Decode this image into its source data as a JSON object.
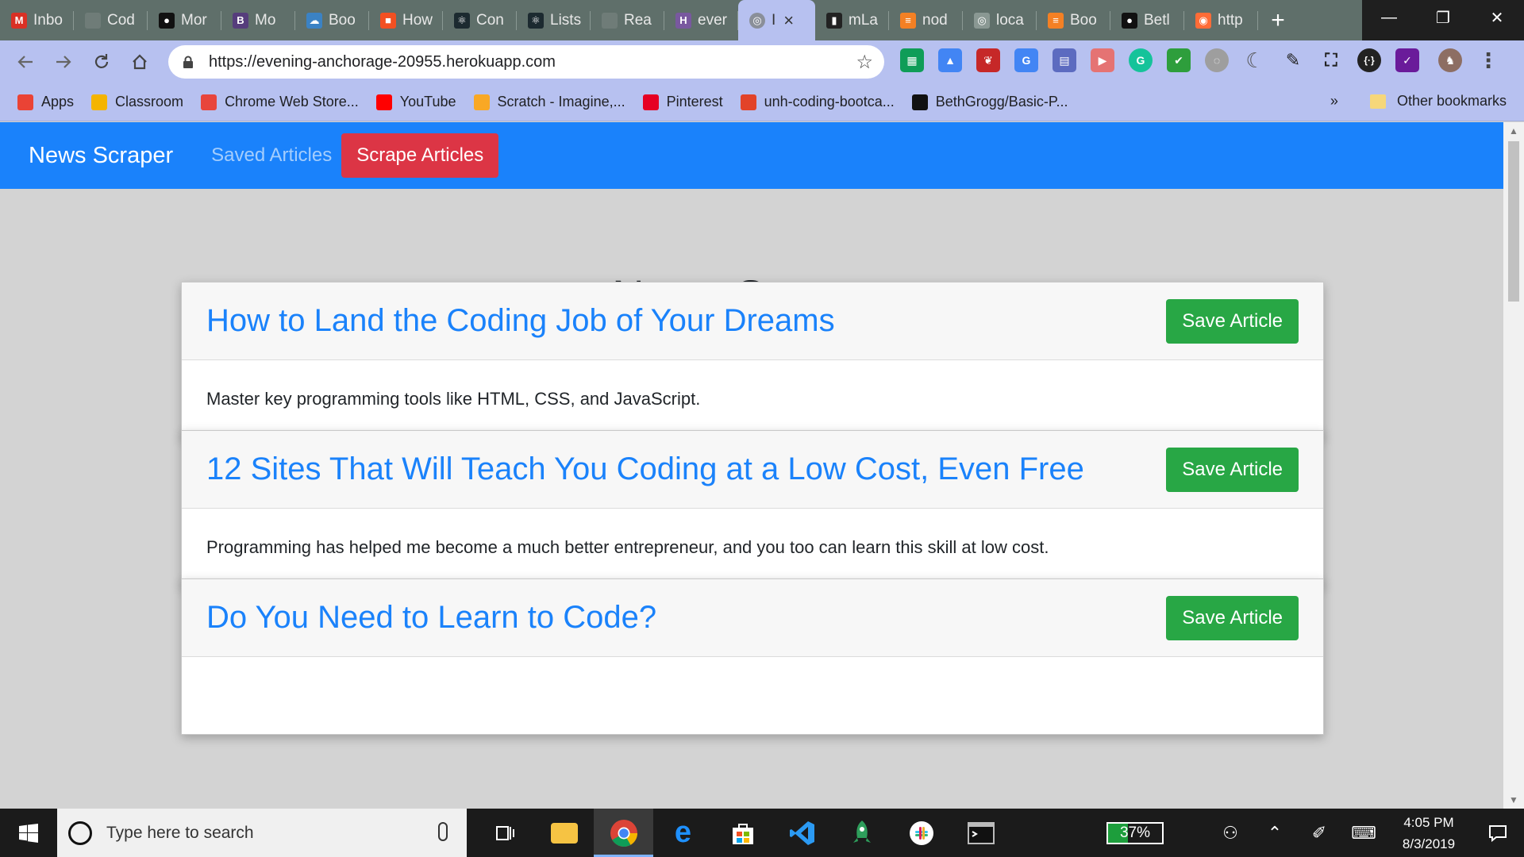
{
  "browser": {
    "tabs": [
      {
        "label": "Inbo",
        "icon": "gmail-icon",
        "color": "#d93025",
        "glyph": "M"
      },
      {
        "label": "Cod",
        "icon": "generic-site-icon",
        "color": "#6f7c78",
        "glyph": ""
      },
      {
        "label": "Mor",
        "icon": "github-icon",
        "color": "#111111",
        "glyph": "●"
      },
      {
        "label": "Mo",
        "icon": "bootstrap-icon",
        "color": "#563d7c",
        "glyph": "B"
      },
      {
        "label": "Boo",
        "icon": "cloud-icon",
        "color": "#3b82c4",
        "glyph": "☁"
      },
      {
        "label": "How",
        "icon": "microsoft-icon",
        "color": "#f25022",
        "glyph": "■"
      },
      {
        "label": "Con",
        "icon": "react-icon",
        "color": "#1c2a30",
        "glyph": "⚛"
      },
      {
        "label": "Lists",
        "icon": "react-icon",
        "color": "#1c2a30",
        "glyph": "⚛"
      },
      {
        "label": "Rea",
        "icon": "generic-site-icon",
        "color": "#6f7c78",
        "glyph": ""
      },
      {
        "label": "ever",
        "icon": "heroku-icon",
        "color": "#79589f",
        "glyph": "H"
      }
    ],
    "active_tab": {
      "label": "I",
      "icon": "globe-icon"
    },
    "tabs_after": [
      {
        "label": "mLa",
        "icon": "mlab-icon",
        "color": "#222222",
        "glyph": "▮"
      },
      {
        "label": "nod",
        "icon": "stackoverflow-icon",
        "color": "#f48024",
        "glyph": "≡"
      },
      {
        "label": "loca",
        "icon": "globe-icon",
        "color": "#8a9893",
        "glyph": "◎"
      },
      {
        "label": "Boo",
        "icon": "stackoverflow-icon",
        "color": "#f48024",
        "glyph": "≡"
      },
      {
        "label": "Betl",
        "icon": "github-icon",
        "color": "#111111",
        "glyph": "●"
      },
      {
        "label": "http",
        "icon": "postman-icon",
        "color": "#ff6c37",
        "glyph": "◉"
      }
    ],
    "url": "https://evening-anchorage-20955.herokuapp.com",
    "bookmarks": [
      {
        "label": "Apps",
        "icon": "apps-grid-icon",
        "color": "#ea4335"
      },
      {
        "label": "Classroom",
        "icon": "classroom-icon",
        "color": "#f4b400"
      },
      {
        "label": "Chrome Web Store...",
        "icon": "webstore-icon",
        "color": "#e8453c"
      },
      {
        "label": "YouTube",
        "icon": "youtube-icon",
        "color": "#ff0000"
      },
      {
        "label": "Scratch - Imagine,...",
        "icon": "scratch-icon",
        "color": "#f9a825"
      },
      {
        "label": "Pinterest",
        "icon": "pinterest-icon",
        "color": "#e60023"
      },
      {
        "label": "unh-coding-bootca...",
        "icon": "gitlab-icon",
        "color": "#e24329"
      },
      {
        "label": "BethGrogg/Basic-P...",
        "icon": "github-icon",
        "color": "#111111"
      }
    ],
    "overflow_label": "»",
    "other_bookmarks": "Other bookmarks"
  },
  "page": {
    "brand": "News Scraper",
    "nav_saved": "Saved Articles",
    "nav_scrape": "Scrape Articles",
    "heading": "News Scraper",
    "save_label": "Save Article",
    "articles": [
      {
        "title": "How to Land the Coding Job of Your Dreams",
        "summary": "Master key programming tools like HTML, CSS, and JavaScript."
      },
      {
        "title": "12 Sites That Will Teach You Coding at a Low Cost, Even Free",
        "summary": "Programming has helped me become a much better entrepreneur, and you too can learn this skill at low cost."
      },
      {
        "title": "Do You Need to Learn to Code?",
        "summary": ""
      }
    ],
    "colors": {
      "navbar": "#1a82fb",
      "scrape": "#dc3545",
      "save": "#28a745",
      "link": "#1a82fb"
    }
  },
  "taskbar": {
    "search_placeholder": "Type here to search",
    "battery_percent": 37,
    "battery_label": "37%",
    "time": "4:05 PM",
    "date": "8/3/2019"
  }
}
